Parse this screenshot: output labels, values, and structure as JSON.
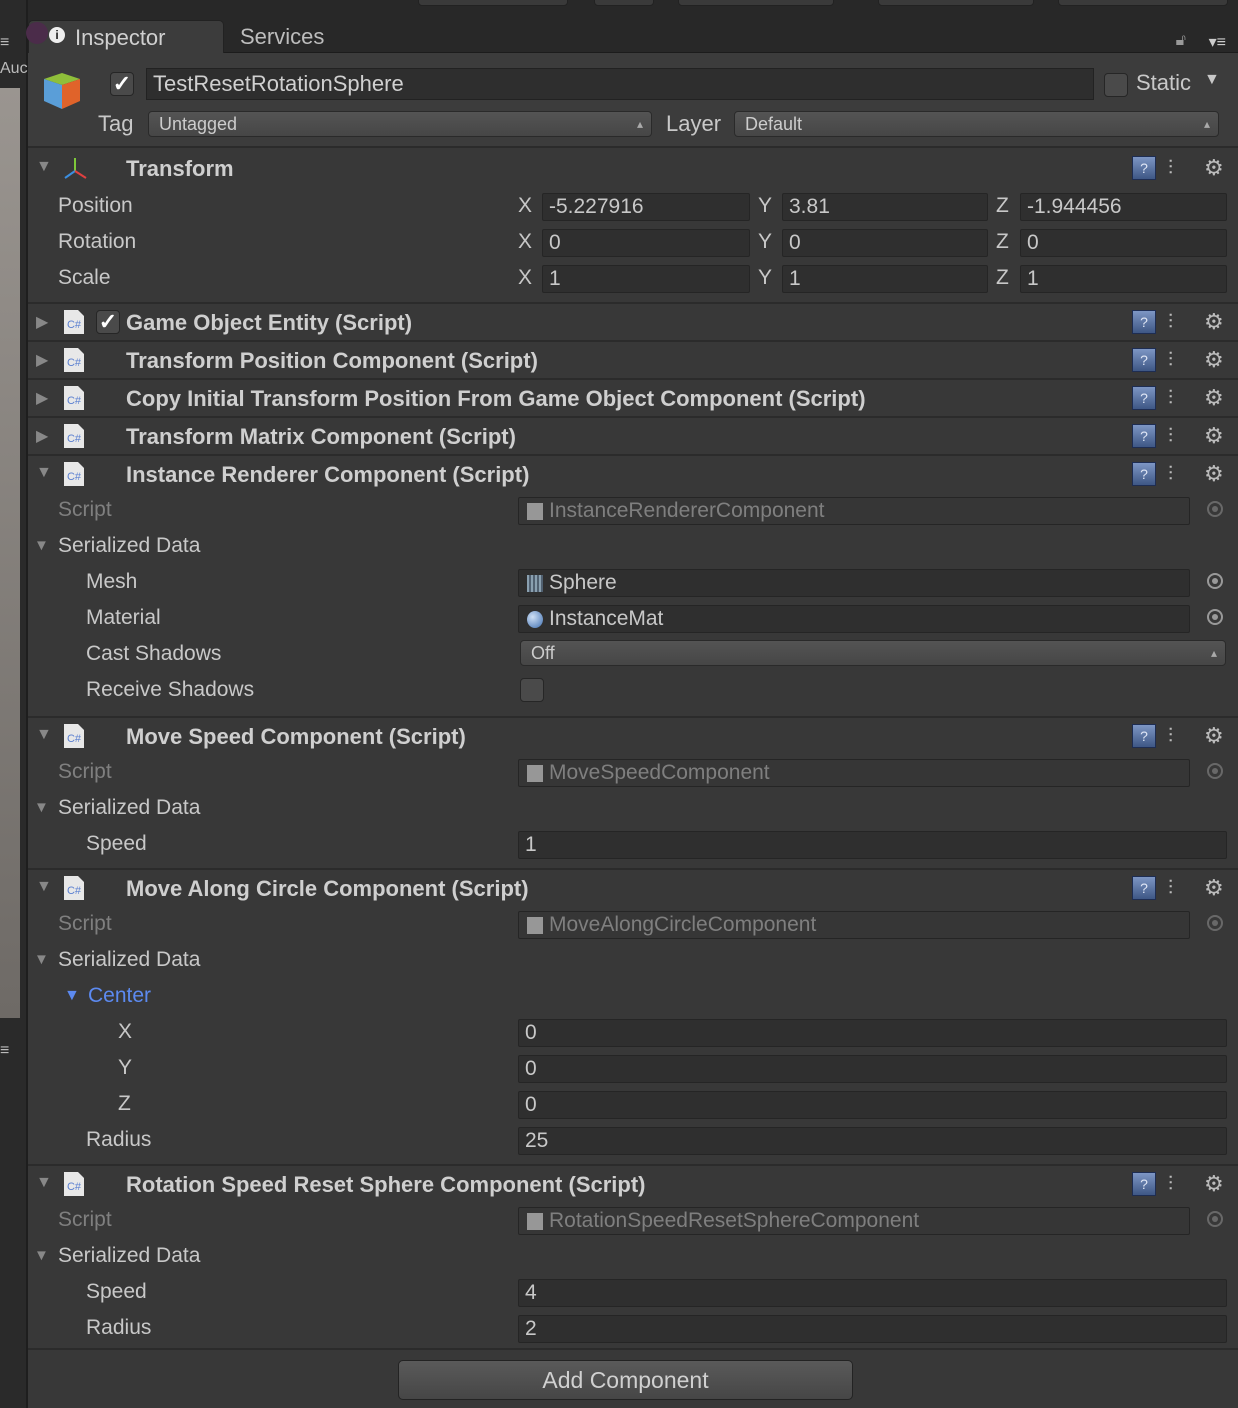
{
  "tabs": {
    "inspector": "Inspector",
    "services": "Services"
  },
  "side": {
    "partial": "Auc"
  },
  "object": {
    "name": "TestResetRotationSphere",
    "active": true,
    "static_label": "Static",
    "static": false,
    "tag_label": "Tag",
    "tag": "Untagged",
    "layer_label": "Layer",
    "layer": "Default"
  },
  "transform": {
    "title": "Transform",
    "rows": [
      {
        "label": "Position",
        "x": "-5.227916",
        "y": "3.81",
        "z": "-1.944456"
      },
      {
        "label": "Rotation",
        "x": "0",
        "y": "0",
        "z": "0"
      },
      {
        "label": "Scale",
        "x": "1",
        "y": "1",
        "z": "1"
      }
    ]
  },
  "axis": {
    "x": "X",
    "y": "Y",
    "z": "Z"
  },
  "components": [
    {
      "title": "Game Object Entity (Script)",
      "checkbox": true,
      "expanded": false,
      "rows": []
    },
    {
      "title": "Transform Position Component (Script)",
      "expanded": false,
      "rows": []
    },
    {
      "title": "Copy Initial Transform Position From Game Object Component (Script)",
      "expanded": false,
      "rows": []
    },
    {
      "title": "Transform Matrix Component (Script)",
      "expanded": false,
      "rows": []
    },
    {
      "title": "Instance Renderer Component (Script)",
      "expanded": true,
      "rows": [
        {
          "kind": "script",
          "label": "Script",
          "value": "InstanceRendererComponent"
        },
        {
          "kind": "fold",
          "label": "Serialized Data"
        },
        {
          "kind": "object",
          "label": "Mesh",
          "value": "Sphere",
          "icon": "mesh"
        },
        {
          "kind": "object",
          "label": "Material",
          "value": "InstanceMat",
          "icon": "material"
        },
        {
          "kind": "popup",
          "label": "Cast Shadows",
          "value": "Off"
        },
        {
          "kind": "check",
          "label": "Receive Shadows",
          "value": false
        }
      ]
    },
    {
      "title": "Move Speed Component (Script)",
      "expanded": true,
      "rows": [
        {
          "kind": "script",
          "label": "Script",
          "value": "MoveSpeedComponent"
        },
        {
          "kind": "fold",
          "label": "Serialized Data"
        },
        {
          "kind": "num",
          "label": "Speed",
          "value": "1"
        }
      ]
    },
    {
      "title": "Move Along Circle Component (Script)",
      "expanded": true,
      "rows": [
        {
          "kind": "script",
          "label": "Script",
          "value": "MoveAlongCircleComponent"
        },
        {
          "kind": "fold",
          "label": "Serialized Data"
        },
        {
          "kind": "subfold",
          "label": "Center"
        },
        {
          "kind": "num",
          "label": "X",
          "value": "0",
          "indent": 2
        },
        {
          "kind": "num",
          "label": "Y",
          "value": "0",
          "indent": 2
        },
        {
          "kind": "num",
          "label": "Z",
          "value": "0",
          "indent": 2
        },
        {
          "kind": "num",
          "label": "Radius",
          "value": "25"
        }
      ]
    },
    {
      "title": "Rotation Speed Reset Sphere Component (Script)",
      "expanded": true,
      "rows": [
        {
          "kind": "script",
          "label": "Script",
          "value": "RotationSpeedResetSphereComponent"
        },
        {
          "kind": "fold",
          "label": "Serialized Data"
        },
        {
          "kind": "num",
          "label": "Speed",
          "value": "4"
        },
        {
          "kind": "num",
          "label": "Radius",
          "value": "2"
        }
      ]
    }
  ],
  "add_component": "Add Component",
  "colors": {
    "accent": "#5c8af0",
    "panel": "#383838"
  }
}
